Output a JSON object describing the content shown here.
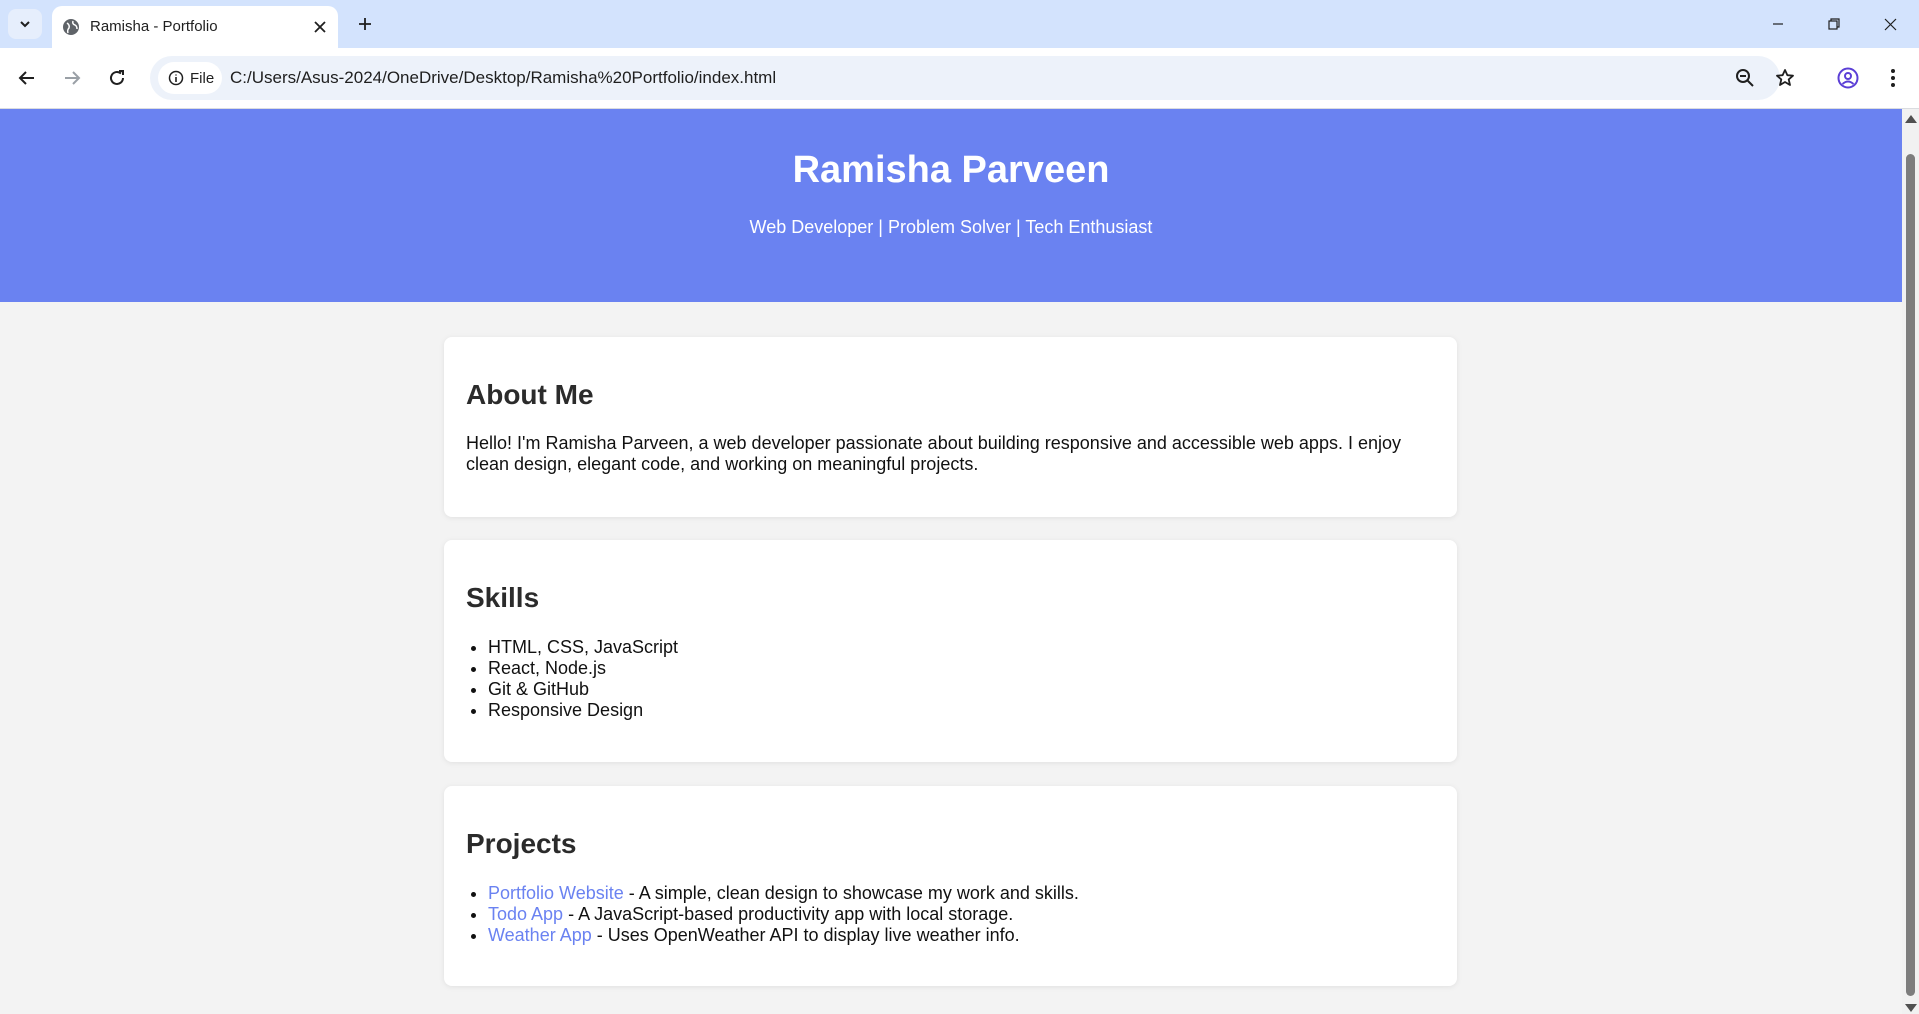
{
  "browser": {
    "tab_title": "Ramisha - Portfolio",
    "address_chip": "File",
    "url": "C:/Users/Asus-2024/OneDrive/Desktop/Ramisha%20Portfolio/index.html"
  },
  "header": {
    "name": "Ramisha Parveen",
    "tagline": "Web Developer | Problem Solver | Tech Enthusiast"
  },
  "about": {
    "heading": "About Me",
    "text": "Hello! I'm Ramisha Parveen, a web developer passionate about building responsive and accessible web apps. I enjoy clean design, elegant code, and working on meaningful projects."
  },
  "skills": {
    "heading": "Skills",
    "items": [
      "HTML, CSS, JavaScript",
      "React, Node.js",
      "Git & GitHub",
      "Responsive Design"
    ]
  },
  "projects": {
    "heading": "Projects",
    "items": [
      {
        "link": "Portfolio Website",
        "desc": " - A simple, clean design to showcase my work and skills."
      },
      {
        "link": "Todo App",
        "desc": " - A JavaScript-based productivity app with local storage."
      },
      {
        "link": "Weather App",
        "desc": " - Uses OpenWeather API to display live weather info."
      }
    ]
  },
  "colors": {
    "accent": "#6a82f1",
    "page_bg": "#f3f3f3",
    "tabbar_bg": "#d3e3fd"
  }
}
